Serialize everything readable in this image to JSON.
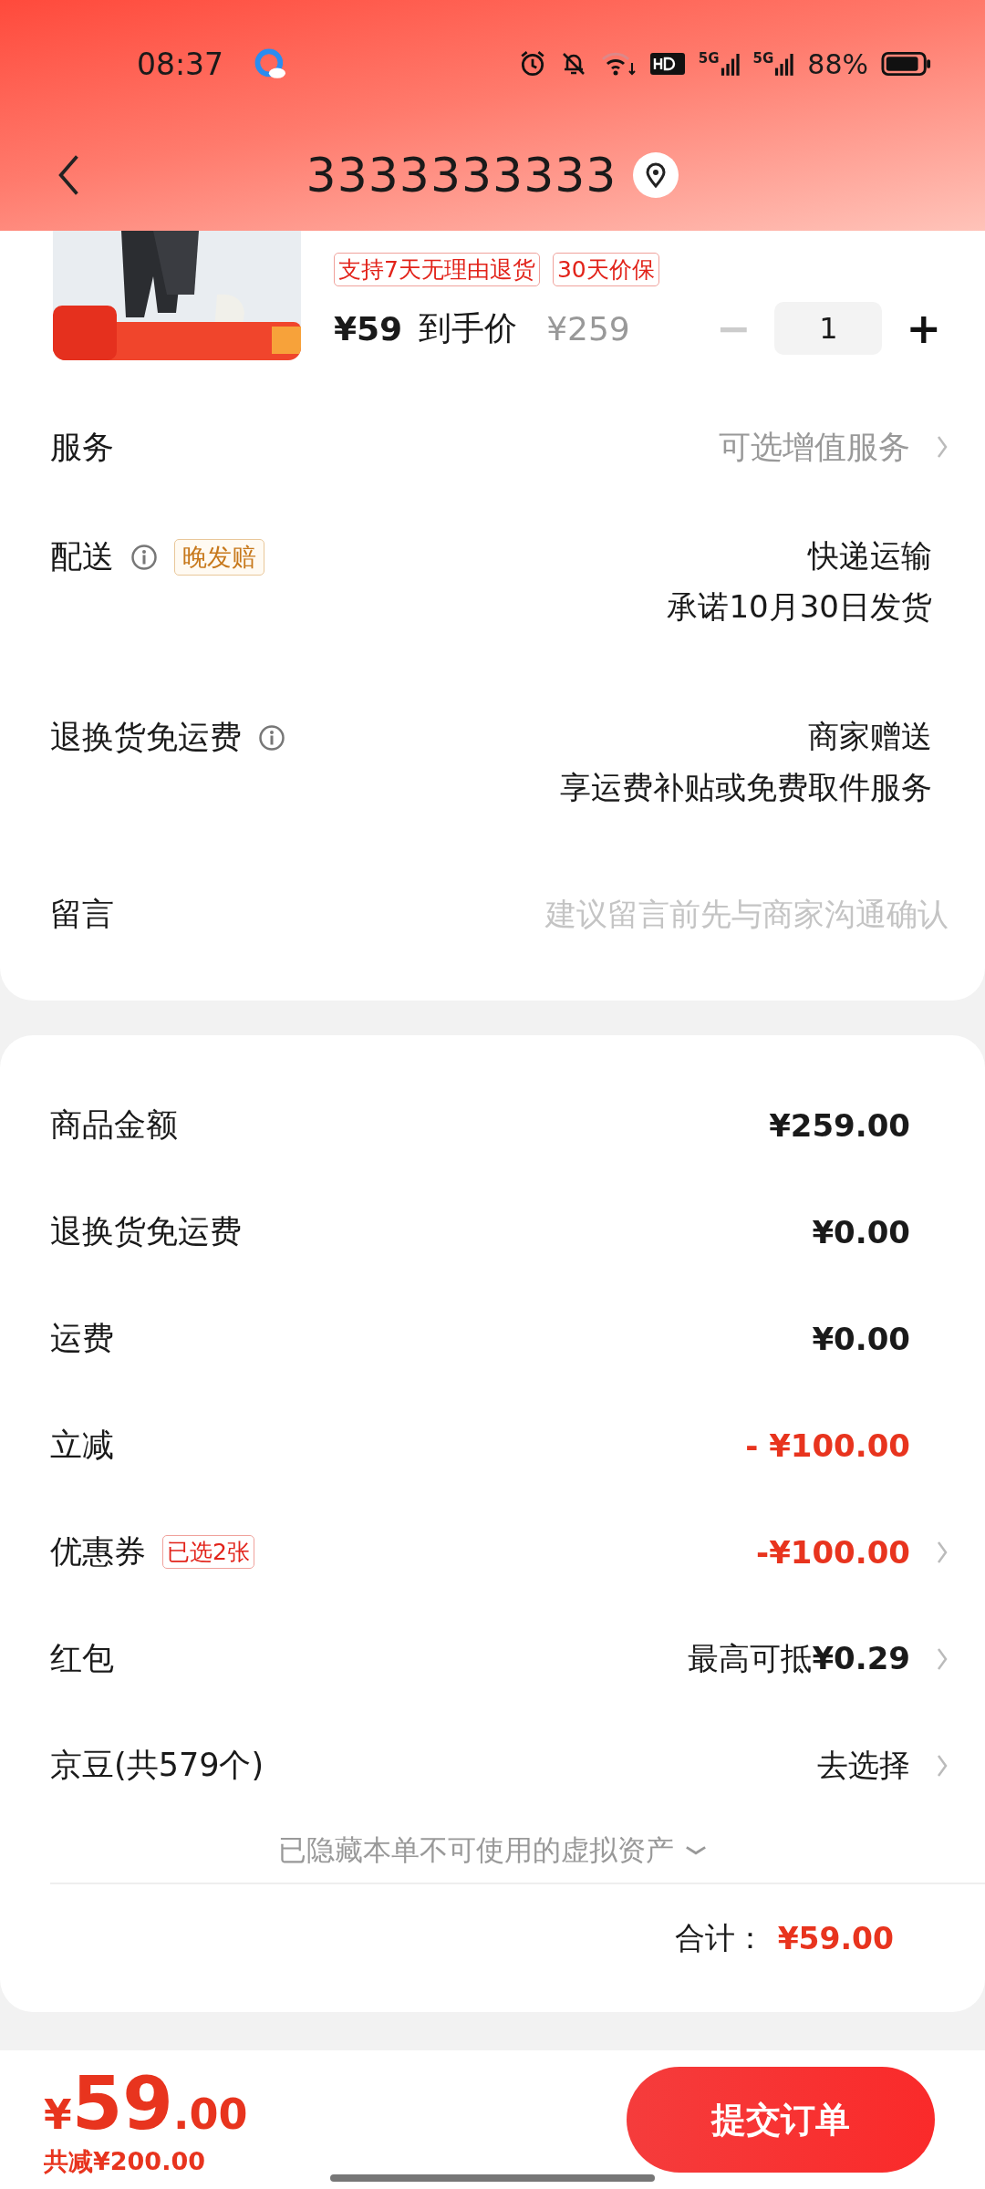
{
  "status_bar": {
    "time": "08:37",
    "network_labels": [
      "5G",
      "5G"
    ],
    "battery": "88%"
  },
  "header": {
    "title": "3333333333"
  },
  "product": {
    "tags": [
      "支持7天无理由退货",
      "30天价保"
    ],
    "price": "¥59",
    "price_label": "到手价",
    "original_price": "¥259",
    "quantity": {
      "value": "1",
      "decrease": "−",
      "increase": "+",
      "decrease_disabled": true
    }
  },
  "services": [
    {
      "kind": "link",
      "label": "服务",
      "value_lines": [
        "可选增值服务"
      ]
    },
    {
      "kind": "info",
      "label": "配送",
      "badge": "晚发赔",
      "value_lines": [
        "快递运输",
        "承诺10月30日发货"
      ]
    },
    {
      "kind": "info",
      "label": "退换货免运费",
      "value_lines": [
        "商家赠送",
        "享运费补贴或免费取件服务"
      ]
    },
    {
      "kind": "input",
      "label": "留言",
      "placeholder": "建议留言前先与商家沟通确认"
    }
  ],
  "summary": {
    "rows": [
      {
        "kind": "amount",
        "label": "商品金额",
        "value": "¥259.00",
        "discount": false,
        "chevron": false
      },
      {
        "kind": "amount",
        "label": "退换货免运费",
        "value": "¥0.00",
        "discount": false,
        "chevron": false
      },
      {
        "kind": "amount",
        "label": "运费",
        "value": "¥0.00",
        "discount": false,
        "chevron": false
      },
      {
        "kind": "amount",
        "label": "立减",
        "value": "- ¥100.00",
        "discount": true,
        "chevron": false
      },
      {
        "kind": "amount",
        "label": "优惠券",
        "badge": "已选2张",
        "value": "-¥100.00",
        "discount": true,
        "chevron": true
      },
      {
        "kind": "action",
        "label": "红包",
        "value": "最高可抵**¥0.29**",
        "discount": false,
        "chevron": true
      },
      {
        "kind": "action",
        "label": "京豆(共579个)",
        "value": "去选择",
        "discount": false,
        "chevron": true
      }
    ],
    "hidden_note": "已隐藏本单不可使用的虚拟资产",
    "total_label": "合计：",
    "total": "¥59.00"
  },
  "footer": {
    "currency": "¥",
    "price_integer": "59",
    "price_decimal": ".00",
    "saved": "共减¥200.00",
    "submit": "提交订单"
  }
}
